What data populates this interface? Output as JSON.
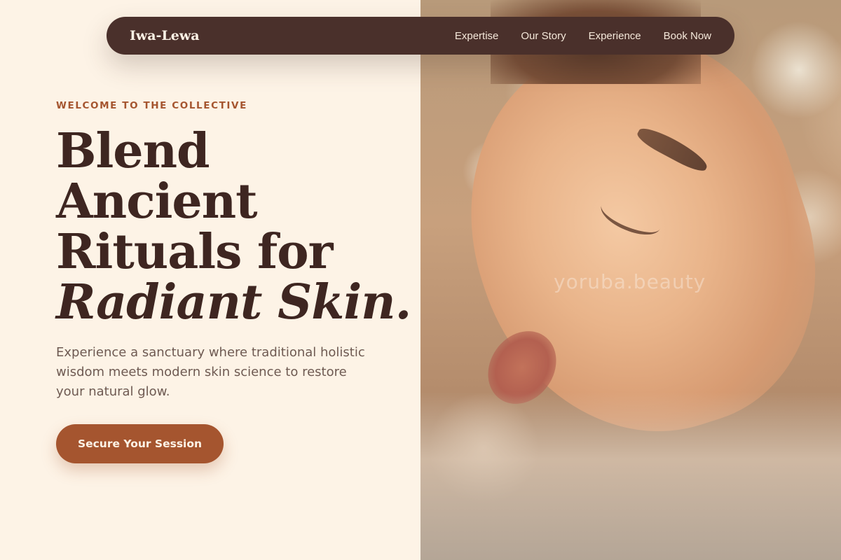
{
  "nav": {
    "brand": "Iwa-Lewa",
    "links": [
      "Expertise",
      "Our Story",
      "Experience",
      "Book Now"
    ]
  },
  "hero": {
    "eyebrow": "WELCOME TO THE COLLECTIVE",
    "headline_lines": [
      "Blend",
      "Ancient",
      "Rituals for"
    ],
    "headline_accent": "Radiant Skin.",
    "subtext": "Experience a sanctuary where traditional holistic wisdom meets modern skin science to restore your natural glow.",
    "cta_label": "Secure Your Session"
  },
  "image": {
    "watermark": "yoruba.beauty"
  },
  "colors": {
    "background": "#fdf3e6",
    "nav_bg": "#4a302b",
    "accent": "#a5552f",
    "heading": "#3e2621",
    "body_text": "#6e5a52"
  }
}
